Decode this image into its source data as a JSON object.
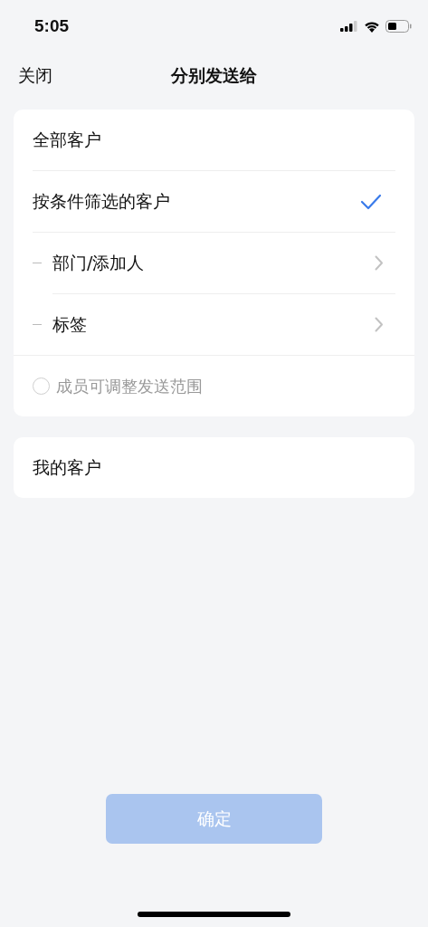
{
  "status_bar": {
    "time": "5:05"
  },
  "nav": {
    "close": "关闭",
    "title": "分别发送给"
  },
  "groups": [
    {
      "items": [
        {
          "kind": "option",
          "label": "全部客户",
          "selected": false
        },
        {
          "kind": "option",
          "label": "按条件筛选的客户",
          "selected": true
        },
        {
          "kind": "sub",
          "label": "部门/添加人"
        },
        {
          "kind": "sub",
          "label": "标签"
        }
      ],
      "checkbox": {
        "label": "成员可调整发送范围",
        "checked": false
      }
    },
    {
      "items": [
        {
          "kind": "option",
          "label": "我的客户",
          "selected": false
        }
      ]
    }
  ],
  "confirm": {
    "label": "确定",
    "disabled": true
  }
}
